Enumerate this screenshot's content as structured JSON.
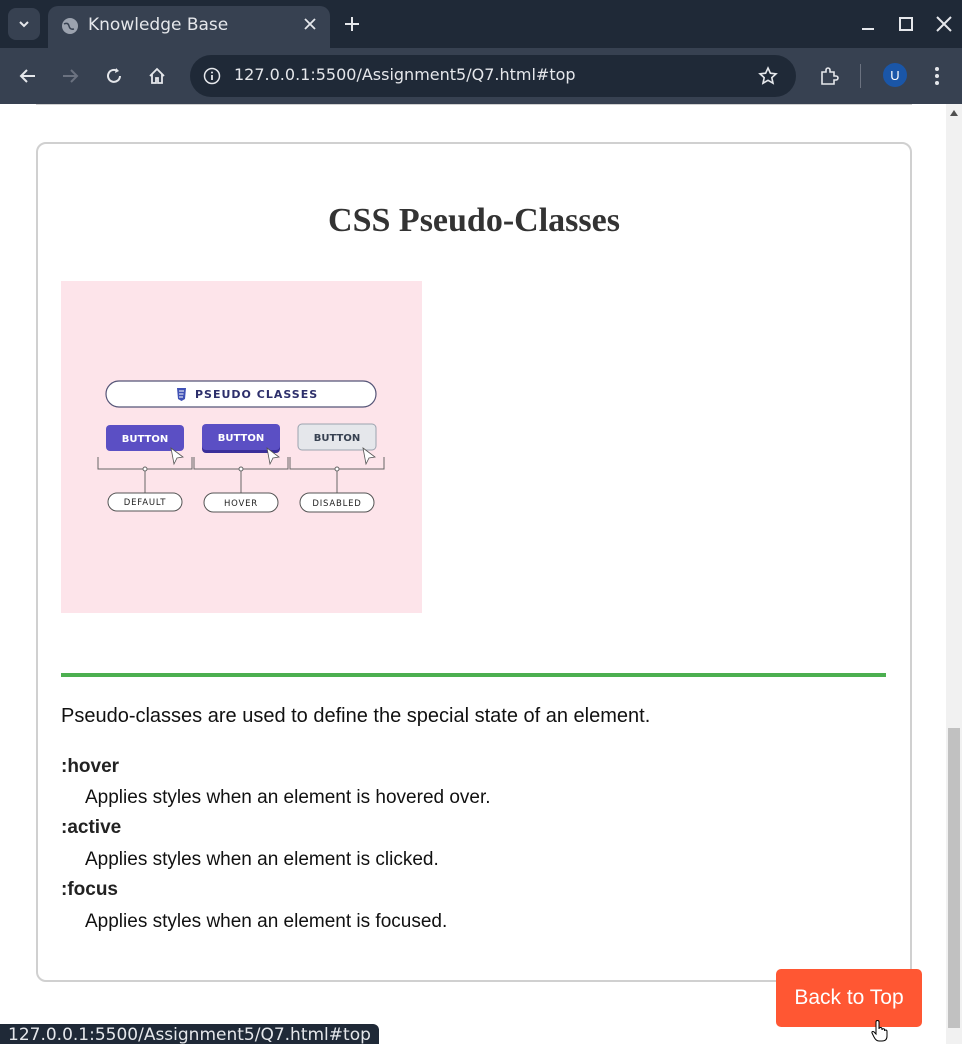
{
  "browser": {
    "tab_title": "Knowledge Base",
    "url": "127.0.0.1:5500/Assignment5/Q7.html#top",
    "avatar_letter": "U",
    "status_url": "127.0.0.1:5500/Assignment5/Q7.html#top"
  },
  "page": {
    "title": "CSS Pseudo-Classes",
    "illustration": {
      "header": "PSEUDO CLASSES",
      "button_label": "BUTTON",
      "states": [
        "DEFAULT",
        "HOVER",
        "DISABLED"
      ],
      "colors": {
        "background": "#fde4ea",
        "button": "#5b4fc4",
        "disabled": "#e5e7eb"
      }
    },
    "intro": "Pseudo-classes are used to define the special state of an element.",
    "items": [
      {
        "term": ":hover",
        "desc": "Applies styles when an element is hovered over."
      },
      {
        "term": ":active",
        "desc": "Applies styles when an element is clicked."
      },
      {
        "term": ":focus",
        "desc": "Applies styles when an element is focused."
      }
    ],
    "back_to_top": "Back to Top"
  },
  "colors": {
    "accent_rule": "#4caf50",
    "back_button": "#ff5733"
  }
}
